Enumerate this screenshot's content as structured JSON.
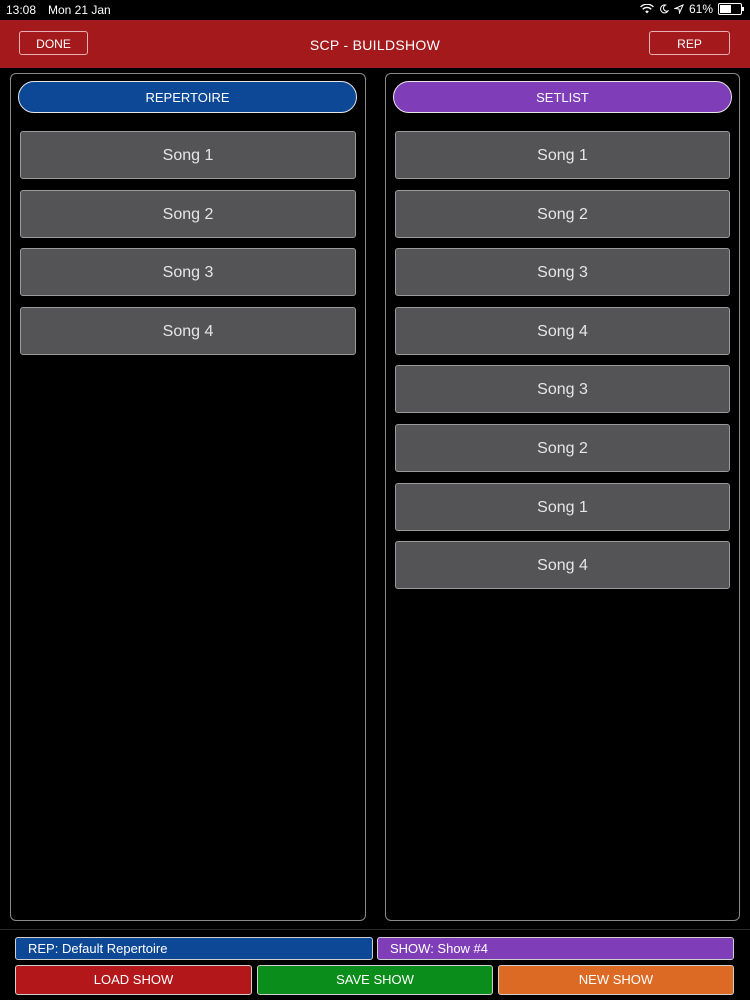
{
  "status_bar": {
    "time": "13:08",
    "date": "Mon 21 Jan",
    "battery": "61%",
    "battery_level": 0.61
  },
  "header": {
    "title": "SCP - BUILDSHOW",
    "done_label": "DONE",
    "rep_label": "REP",
    "color": "#a4191b"
  },
  "repertoire": {
    "label": "REPERTOIRE",
    "color": "#0d4896",
    "songs": [
      "Song 1",
      "Song 2",
      "Song 3",
      "Song 4"
    ]
  },
  "setlist": {
    "label": "SETLIST",
    "color": "#7f3db8",
    "songs": [
      "Song 1",
      "Song 2",
      "Song 3",
      "Song 4",
      "Song 3",
      "Song 2",
      "Song 1",
      "Song 4"
    ]
  },
  "footer": {
    "rep_info": "REP: Default Repertoire",
    "show_info": "SHOW: Show #4",
    "load_label": "LOAD SHOW",
    "save_label": "SAVE SHOW",
    "new_label": "NEW SHOW",
    "load_color": "#b3171a",
    "save_color": "#0b8d1b",
    "new_color": "#dc6a24"
  }
}
